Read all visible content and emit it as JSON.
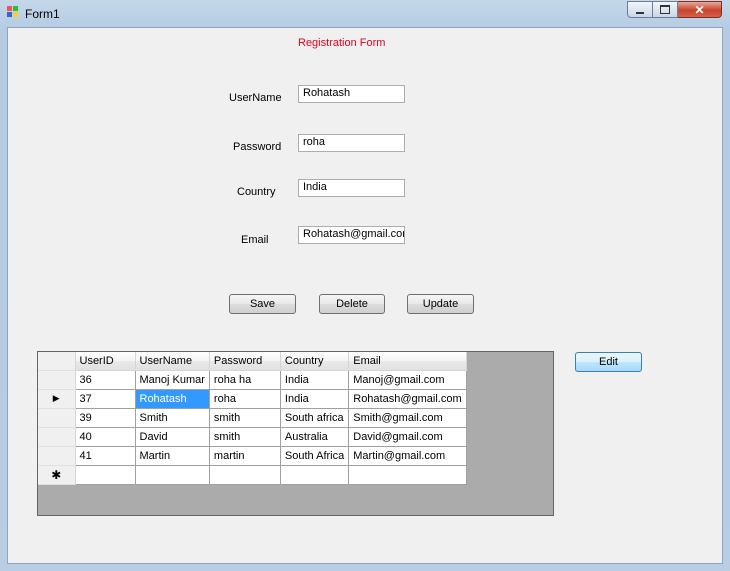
{
  "window": {
    "title": "Form1"
  },
  "form": {
    "heading": "Registration Form",
    "fields": [
      {
        "label": "UserName",
        "value": "Rohatash"
      },
      {
        "label": "Password",
        "value": "roha"
      },
      {
        "label": "Country",
        "value": "India"
      },
      {
        "label": "Email",
        "value": "Rohatash@gmail.com"
      }
    ],
    "buttons": {
      "save": "Save",
      "delete": "Delete",
      "update": "Update",
      "edit": "Edit"
    }
  },
  "grid": {
    "columns": [
      "UserID",
      "UserName",
      "Password",
      "Country",
      "Email"
    ],
    "rows": [
      [
        "36",
        "Manoj Kumar",
        "roha ha",
        "India",
        "Manoj@gmail.com"
      ],
      [
        "37",
        "Rohatash",
        "roha",
        "India",
        "Rohatash@gmail.com"
      ],
      [
        "39",
        "Smith",
        "smith",
        "South africa",
        "Smith@gmail.com"
      ],
      [
        "40",
        "David",
        "smith",
        "Australia",
        "David@gmail.com"
      ],
      [
        "41",
        "Martin",
        "martin",
        "South Africa",
        "Martin@gmail.com"
      ]
    ],
    "current_row_marker": "▶",
    "new_row_marker": "✱",
    "selected_cell": "Rohatash"
  },
  "colors": {
    "heading": "#e8001c",
    "selection": "#3399ff"
  }
}
